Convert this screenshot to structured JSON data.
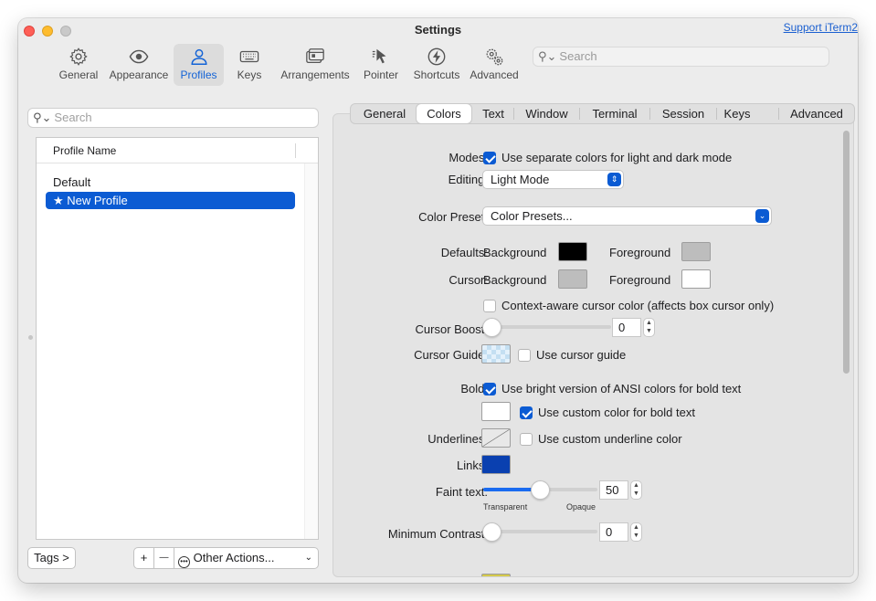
{
  "window": {
    "title": "Settings",
    "support_link": "Support iTerm2"
  },
  "toolbar": {
    "items": [
      {
        "label": "General",
        "icon": "gear-icon"
      },
      {
        "label": "Appearance",
        "icon": "eye-icon"
      },
      {
        "label": "Profiles",
        "icon": "person-icon",
        "active": true
      },
      {
        "label": "Keys",
        "icon": "keyboard-icon"
      },
      {
        "label": "Arrangements",
        "icon": "windows-icon"
      },
      {
        "label": "Pointer",
        "icon": "pointer-icon"
      },
      {
        "label": "Shortcuts",
        "icon": "bolt-icon"
      },
      {
        "label": "Advanced",
        "icon": "gears-icon"
      }
    ],
    "search_placeholder": "Search"
  },
  "profiles": {
    "search_placeholder": "Search",
    "column_header": "Profile Name",
    "items": [
      {
        "name": "Default",
        "selected": false
      },
      {
        "name": "★ New Profile",
        "selected": true
      }
    ],
    "tags_button": "Tags >",
    "add_button": "+",
    "remove_button": "—",
    "other_actions": "Other Actions..."
  },
  "tabs": {
    "items": [
      "General",
      "Colors",
      "Text",
      "Window",
      "Terminal",
      "Session",
      "Keys",
      "Advanced"
    ],
    "active": "Colors"
  },
  "colors": {
    "modes_label": "Modes:",
    "modes_checkbox": "Use separate colors for light and dark mode",
    "modes_checked": true,
    "editing_label": "Editing:",
    "editing_value": "Light Mode",
    "preset_label": "Color Preset:",
    "preset_value": "Color Presets...",
    "defaults_label": "Defaults:",
    "cursor_label": "Cursor:",
    "background_label": "Background",
    "foreground_label": "Foreground",
    "defaults_background_color": "#000000",
    "defaults_foreground_color": "#bdbdbd",
    "cursor_background_color": "#bdbdbd",
    "cursor_foreground_color": "#ffffff",
    "context_aware_label": "Context-aware cursor color (affects box cursor only)",
    "context_aware_checked": false,
    "cursor_boost_label": "Cursor Boost:",
    "cursor_boost_value": "0",
    "cursor_guide_label": "Cursor Guide:",
    "cursor_guide_checkbox": "Use cursor guide",
    "cursor_guide_checked": false,
    "bold_label": "Bold:",
    "bold_bright_checkbox": "Use bright version of ANSI colors for bold text",
    "bold_bright_checked": true,
    "bold_custom_checkbox": "Use custom color for bold text",
    "bold_custom_checked": true,
    "bold_color": "#ffffff",
    "underlines_label": "Underlines:",
    "underline_checkbox": "Use custom underline color",
    "underline_checked": false,
    "links_label": "Links:",
    "links_color": "#0a40b0",
    "faint_label": "Faint text:",
    "faint_value": "50",
    "faint_fraction": 0.5,
    "faint_min_label": "Transparent",
    "faint_max_label": "Opaque",
    "min_contrast_label": "Minimum Contrast:",
    "min_contrast_value": "0"
  },
  "accent_color": "#0b5bd3"
}
